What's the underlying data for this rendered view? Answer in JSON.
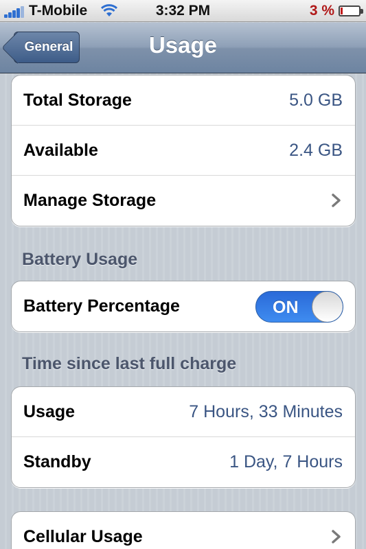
{
  "status_bar": {
    "carrier": "T-Mobile",
    "time": "3:32 PM",
    "battery_percent": "3 %",
    "battery_level": 0.03
  },
  "nav": {
    "back_label": "General",
    "title": "Usage"
  },
  "storage": {
    "rows": [
      {
        "label": "Total Storage",
        "value": "5.0 GB"
      },
      {
        "label": "Available",
        "value": "2.4 GB"
      },
      {
        "label": "Manage Storage"
      }
    ]
  },
  "battery_usage": {
    "header": "Battery Usage",
    "row_label": "Battery Percentage",
    "toggle_state": "ON"
  },
  "time_since_charge": {
    "header": "Time since last full charge",
    "rows": [
      {
        "label": "Usage",
        "value": "7 Hours, 33 Minutes"
      },
      {
        "label": "Standby",
        "value": "1 Day, 7 Hours"
      }
    ]
  },
  "cellular": {
    "label": "Cellular Usage"
  },
  "colors": {
    "value_text": "#3a5583",
    "toggle_on": "#2a6ad8",
    "battery_low": "#c21a1a"
  }
}
